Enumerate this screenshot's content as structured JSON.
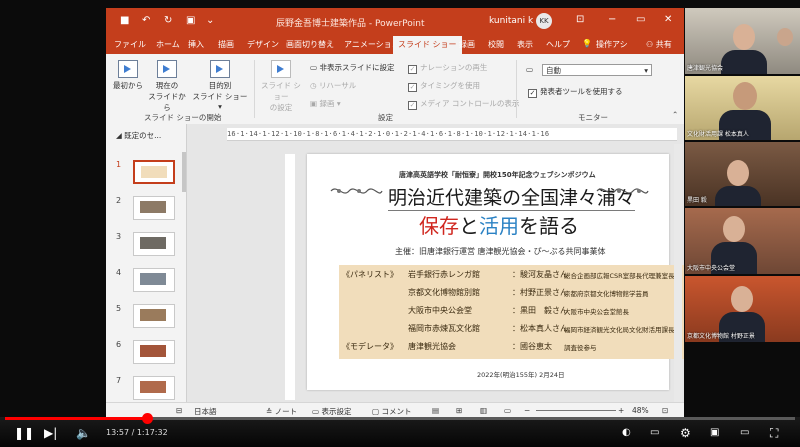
{
  "window": {
    "title": "辰野金吾博士建築作品 - PowerPoint",
    "user": "kunitani k",
    "avatar_initials": "KK",
    "minimize": "−",
    "restore": "▭",
    "close": "✕",
    "share": "共有",
    "tell_me": "操作アシ"
  },
  "tabs": [
    "ファイル",
    "ホーム",
    "挿入",
    "描画",
    "デザイン",
    "画面切り替え",
    "アニメーション",
    "スライド ショー",
    "録画",
    "校閲",
    "表示",
    "ヘルプ"
  ],
  "active_tab": "スライド ショー",
  "ribbon": {
    "from_beginning": "最初から",
    "from_current_1": "現在の",
    "from_current_2": "スライドから",
    "custom_1": "目的別",
    "custom_2": "スライド ショー ▾",
    "setup_1": "スライド ショー",
    "setup_2": "の設定",
    "hide_slide": "非表示スライドに設定",
    "rehearse": "リハーサル",
    "record": "録画 ▾",
    "play_narration": "ナレーションの再生",
    "use_timings": "タイミングを使用",
    "media_controls": "メディア コントロールの表示",
    "monitor_select": "自動",
    "presenter_view": "発表者ツールを使用する",
    "group_start": "スライド ショーの開始",
    "group_setup": "設定",
    "group_monitor": "モニター"
  },
  "slide_panel": {
    "section": "既定のセ...",
    "numbers": [
      "1",
      "2",
      "3",
      "4",
      "5",
      "6",
      "7",
      "8"
    ]
  },
  "ruler": {
    "text": "16·1·14·1·12·1·10·1·8·1·6·1·4·1·2·1·0·1·2·1·4·1·6·1·8·1·10·1·12·1·14·1·16"
  },
  "slide": {
    "subtitle": "唐津高英語学校「耐恒寮」開校150年記念ウェブシンポジウム",
    "title_line1": "明治近代建築の全国津々浦々",
    "title_p1": "保存",
    "title_p2": "と",
    "title_p3": "活用",
    "title_p4": "を語る",
    "organizer": "主催：旧唐津銀行運営 唐津観光協会・ぴ～ぷる共同事業体",
    "panel": [
      {
        "role": "《パネリスト》",
        "venue": "岩手銀行赤レンガ館",
        "name": "：駿河友晶さん",
        "title": "総合企画部広報CSR室部長代理兼室長"
      },
      {
        "role": "",
        "venue": "京都文化博物館別館",
        "name": "：村野正景さん",
        "title": "京都府京都文化博物館学芸員"
      },
      {
        "role": "",
        "venue": "大阪市中央公会堂",
        "name": "：黒田　毅さん",
        "title": "大阪市中央公会堂館長"
      },
      {
        "role": "",
        "venue": "福岡市赤煉瓦文化館",
        "name": "：松本真人さん",
        "title": "福岡市経済観光文化局文化財活用課長"
      },
      {
        "role": "《モデレータ》",
        "venue": "唐津観光協会",
        "name": "：國谷恵太",
        "title": "調査役参与"
      }
    ],
    "date": "2022年(明治155年) 2月24日"
  },
  "status": {
    "language": "日本語",
    "notes": "ノート",
    "display_settings": "表示設定",
    "comments": "コメント",
    "zoom": "48%"
  },
  "feeds": [
    {
      "name": "唐津観光協会"
    },
    {
      "name": "文化財活用課 松本真人"
    },
    {
      "name": "黒田 毅"
    },
    {
      "name": "大阪市中央公会堂"
    },
    {
      "name": "京都文化博物館 村野正景"
    }
  ],
  "player": {
    "time": "13:57 / 1:17:32",
    "progress": 0.18,
    "play_icon": "pause-icon",
    "next_icon": "next-icon",
    "volume_icon": "volume-icon"
  }
}
